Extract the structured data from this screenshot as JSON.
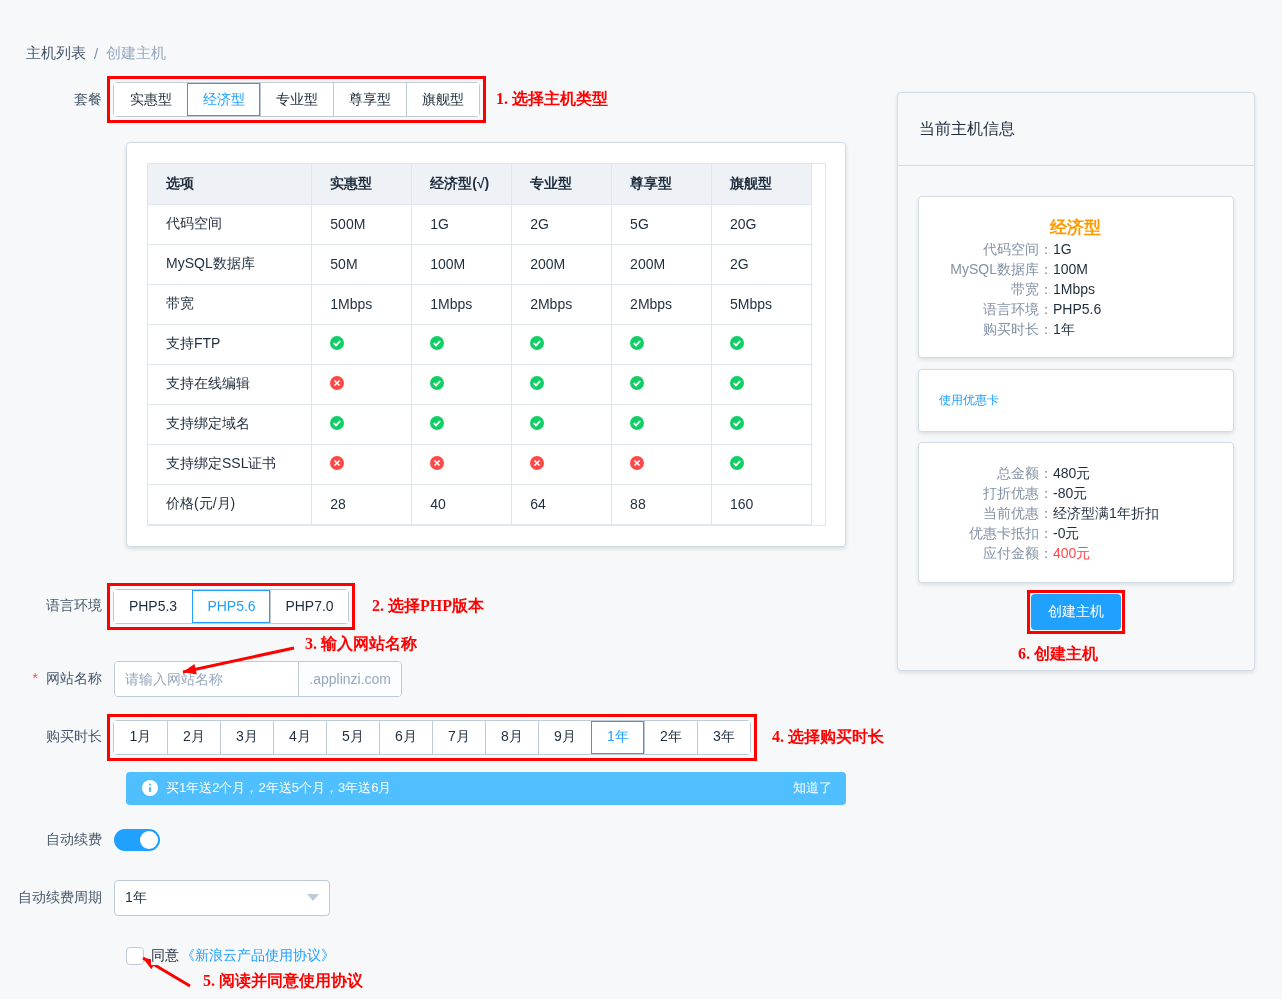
{
  "breadcrumb_separator": "/",
  "breadcrumb": [
    {
      "label": "主机列表",
      "current": false
    },
    {
      "label": "创建主机",
      "current": true
    }
  ],
  "plan": {
    "label": "套餐",
    "annotation": "1. 选择主机类型",
    "options": [
      {
        "label": "实惠型",
        "selected": false
      },
      {
        "label": "经济型",
        "selected": true
      },
      {
        "label": "专业型",
        "selected": false
      },
      {
        "label": "尊享型",
        "selected": false
      },
      {
        "label": "旗舰型",
        "selected": false
      }
    ]
  },
  "comparison_table": {
    "columns": [
      "选项",
      "实惠型",
      "经济型(√)",
      "专业型",
      "尊享型",
      "旗舰型"
    ],
    "rows": [
      {
        "kind": "text",
        "option": "代码空间",
        "values": [
          "500M",
          "1G",
          "2G",
          "5G",
          "20G"
        ]
      },
      {
        "kind": "text",
        "option": "MySQL数据库",
        "values": [
          "50M",
          "100M",
          "200M",
          "200M",
          "2G"
        ]
      },
      {
        "kind": "text",
        "option": "带宽",
        "values": [
          "1Mbps",
          "1Mbps",
          "2Mbps",
          "2Mbps",
          "5Mbps"
        ]
      },
      {
        "kind": "support",
        "option": "支持FTP",
        "supported": [
          true,
          true,
          true,
          true,
          true
        ]
      },
      {
        "kind": "support",
        "option": "支持在线编辑",
        "supported": [
          false,
          true,
          true,
          true,
          true
        ]
      },
      {
        "kind": "support",
        "option": "支持绑定域名",
        "supported": [
          true,
          true,
          true,
          true,
          true
        ]
      },
      {
        "kind": "support",
        "option": "支持绑定SSL证书",
        "supported": [
          false,
          false,
          false,
          false,
          true
        ]
      },
      {
        "kind": "text",
        "option": "价格(元/月)",
        "values": [
          "28",
          "40",
          "64",
          "88",
          "160"
        ]
      }
    ]
  },
  "language": {
    "label": "语言环境",
    "annotation": "2. 选择PHP版本",
    "options": [
      {
        "label": "PHP5.3",
        "selected": false
      },
      {
        "label": "PHP5.6",
        "selected": true
      },
      {
        "label": "PHP7.0",
        "selected": false
      }
    ]
  },
  "site_name": {
    "label": "网站名称",
    "required_mark": "*",
    "placeholder": "请输入网站名称",
    "suffix": ".applinzi.com",
    "annotation": "3. 输入网站名称"
  },
  "duration": {
    "label": "购买时长",
    "annotation": "4. 选择购买时长",
    "options": [
      {
        "label": "1月",
        "selected": false
      },
      {
        "label": "2月",
        "selected": false
      },
      {
        "label": "3月",
        "selected": false
      },
      {
        "label": "4月",
        "selected": false
      },
      {
        "label": "5月",
        "selected": false
      },
      {
        "label": "6月",
        "selected": false
      },
      {
        "label": "7月",
        "selected": false
      },
      {
        "label": "8月",
        "selected": false
      },
      {
        "label": "9月",
        "selected": false
      },
      {
        "label": "1年",
        "selected": true
      },
      {
        "label": "2年",
        "selected": false
      },
      {
        "label": "3年",
        "selected": false
      }
    ]
  },
  "notice": {
    "text": "买1年送2个月，2年送5个月，3年送6月",
    "close": "知道了"
  },
  "auto_renew": {
    "label": "自动续费",
    "on": true
  },
  "renew_period": {
    "label": "自动续费周期",
    "value": "1年"
  },
  "agreement": {
    "checked": false,
    "prefix": "同意",
    "link": "《新浪云产品使用协议》",
    "annotation": "5. 阅读并同意使用协议"
  },
  "summary": {
    "title": "当前主机信息",
    "plan_name": "经济型",
    "specs": [
      {
        "label": "代码空间：",
        "value": "1G"
      },
      {
        "label": "MySQL数据库：",
        "value": "100M"
      },
      {
        "label": "带宽：",
        "value": "1Mbps"
      },
      {
        "label": "语言环境：",
        "value": "PHP5.6"
      },
      {
        "label": "购买时长：",
        "value": "1年"
      }
    ],
    "coupon_link": "使用优惠卡",
    "totals": [
      {
        "label": "总金额：",
        "value": "480元",
        "highlight": false
      },
      {
        "label": "打折优惠：",
        "value": "-80元",
        "highlight": false
      },
      {
        "label": "当前优惠：",
        "value": "经济型满1年折扣",
        "highlight": false
      },
      {
        "label": "优惠卡抵扣：",
        "value": "-0元",
        "highlight": false
      },
      {
        "label": "应付金额：",
        "value": "400元",
        "highlight": true
      }
    ],
    "create_button": "创建主机",
    "annotation": "6. 创建主机"
  }
}
